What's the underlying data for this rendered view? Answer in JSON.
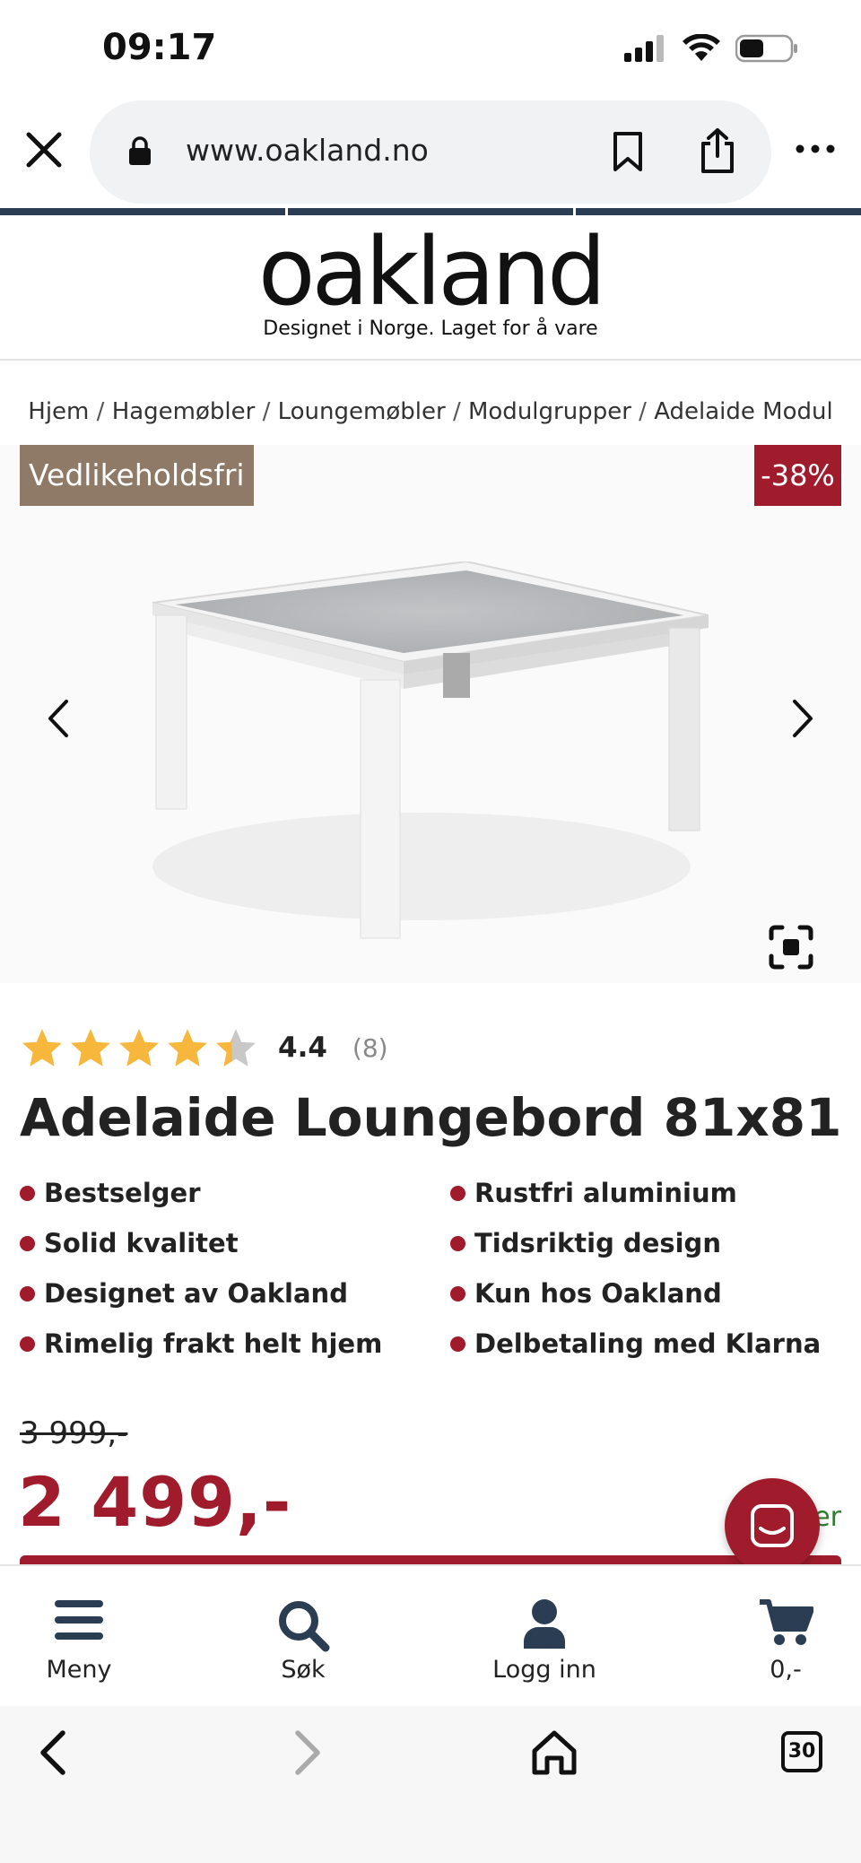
{
  "status": {
    "time": "09:17"
  },
  "browser": {
    "url": "www.oakland.no"
  },
  "header": {
    "logo": "oakland",
    "tagline": "Designet i Norge. Laget for å vare"
  },
  "breadcrumb": [
    "Hjem",
    "Hagemøbler",
    "Loungemøbler",
    "Modulgrupper",
    "Adelaide Modul"
  ],
  "gallery": {
    "badge_left": "Vedlikeholdsfri",
    "badge_right": "-38%"
  },
  "product": {
    "rating_value": "4.4",
    "rating_count": "(8)",
    "rating_fraction": 0.88,
    "title": "Adelaide Loungebord 81x81c...",
    "usps": [
      "Bestselger",
      "Rustfri aluminium",
      "Solid kvalitet",
      "Tidsriktig design",
      "Designet av Oakland",
      "Kun hos Oakland",
      "Rimelig frakt helt hjem",
      "Delbetaling med Klarna"
    ],
    "old_price": "3 999,-",
    "price": "2 499,-",
    "stock_partial": "På lager"
  },
  "bottom_nav": [
    {
      "label": "Meny",
      "icon": "menu-icon"
    },
    {
      "label": "Søk",
      "icon": "search-icon"
    },
    {
      "label": "Logg inn",
      "icon": "user-icon"
    },
    {
      "label": "0,-",
      "icon": "cart-icon"
    }
  ],
  "safari": {
    "tab_count": "30"
  },
  "colors": {
    "brand_red": "#a01c2c",
    "badge_brown": "#8e7a66",
    "navy": "#2b3d52",
    "stock_green": "#2e7d32"
  }
}
